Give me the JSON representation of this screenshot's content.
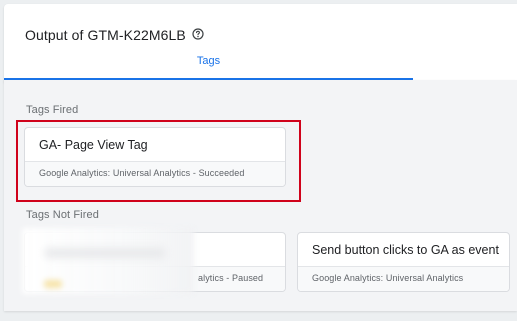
{
  "header": {
    "title": "Output of GTM-K22M6LB",
    "help_icon": "help-circle-icon"
  },
  "tabs": [
    {
      "label": "Tags",
      "active": true
    }
  ],
  "tags_fired": {
    "label": "Tags Fired",
    "cards": [
      {
        "title": "GA- Page View Tag",
        "subtitle": "Google Analytics: Universal Analytics - Succeeded"
      }
    ]
  },
  "tags_not_fired": {
    "label": "Tags Not Fired",
    "cards": [
      {
        "title": "",
        "subtitle": "alytics - Paused"
      },
      {
        "title": "Send button clicks to GA as event",
        "subtitle": "Google Analytics: Universal Analytics"
      }
    ]
  },
  "colors": {
    "accent": "#1a73e8",
    "highlight": "#d0021b"
  }
}
